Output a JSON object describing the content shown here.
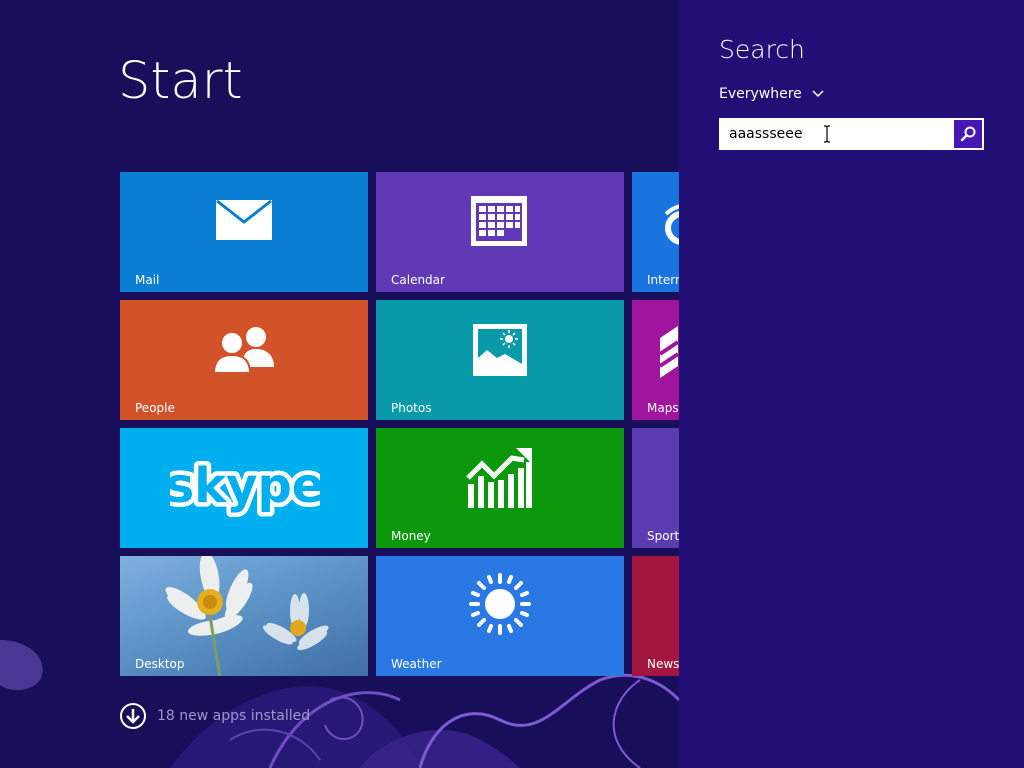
{
  "start": {
    "title": "Start",
    "new_apps_text": "18 new apps installed",
    "tiles": [
      {
        "label": "Mail",
        "color": "#0a7ed3",
        "icon": "mail-icon"
      },
      {
        "label": "Calendar",
        "color": "#6139b4",
        "icon": "calendar-icon"
      },
      {
        "label": "Intern",
        "color": "#1a74e0",
        "icon": "internet-explorer-icon"
      },
      {
        "label": "People",
        "color": "#d2532a",
        "icon": "people-icon"
      },
      {
        "label": "Photos",
        "color": "#089aa8",
        "icon": "photos-icon"
      },
      {
        "label": "Maps",
        "color": "#a0149e",
        "icon": "maps-icon"
      },
      {
        "label": "",
        "color": "#00aff0",
        "icon": "skype-logo"
      },
      {
        "label": "Money",
        "color": "#0c980c",
        "icon": "money-chart-icon"
      },
      {
        "label": "Sports",
        "color": "#5a3cb0",
        "icon": "sports-icon"
      },
      {
        "label": "Desktop",
        "color": "#5d94c8",
        "icon": "desktop-wallpaper"
      },
      {
        "label": "Weather",
        "color": "#2a78e4",
        "icon": "sun-icon"
      },
      {
        "label": "News",
        "color": "#a3173f",
        "icon": "news-icon"
      }
    ],
    "skype_logo_text": "skype"
  },
  "search_charm": {
    "title": "Search",
    "scope": "Everywhere",
    "query": "aaassseee",
    "accent": "#4617b4",
    "background": "#220f75"
  }
}
